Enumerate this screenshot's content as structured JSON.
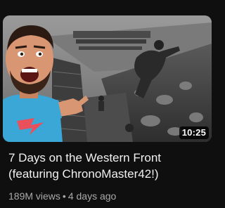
{
  "video": {
    "title_line1": "7 Days on the Western Front",
    "title_line2": "(featuring ChronoMaster42!)",
    "duration": "10:25",
    "views": "189M views",
    "separator": "•",
    "age": "4 days ago",
    "thumbnail_description": "Creator pointing at trench scene"
  },
  "colors": {
    "background": "#0f0f0f",
    "title": "#f1f1f1",
    "meta": "#aaaaaa",
    "shirt": "#3aa7d6"
  }
}
